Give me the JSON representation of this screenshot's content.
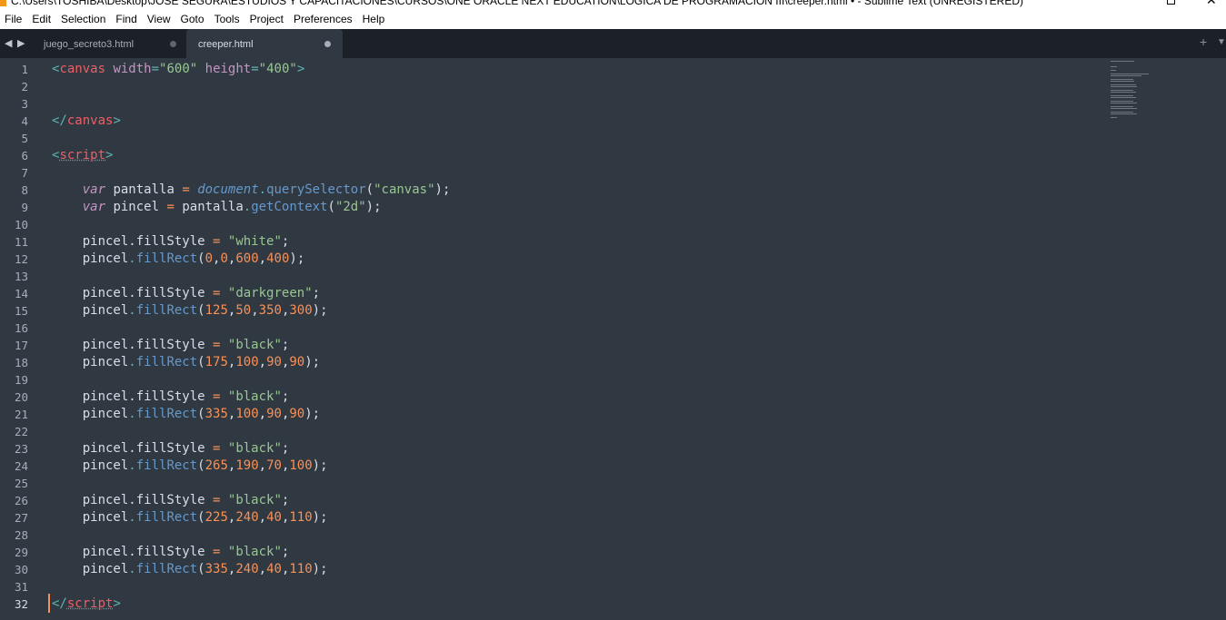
{
  "window": {
    "title": "C:\\Users\\TOSHIBA\\Desktop\\JOSE SEGURA\\ESTUDIOS Y CAPACITACIONES\\CURSOS\\ONE ORACLE NEXT EDUCATION\\LOGICA DE PROGRAMACION III\\creeper.html • - Sublime Text (UNREGISTERED)"
  },
  "menu": [
    "File",
    "Edit",
    "Selection",
    "Find",
    "View",
    "Goto",
    "Tools",
    "Project",
    "Preferences",
    "Help"
  ],
  "tabs": [
    {
      "label": "juego_secreto3.html",
      "active": false,
      "modified": true
    },
    {
      "label": "creeper.html",
      "active": true,
      "modified": true
    }
  ],
  "editor": {
    "current_line": 32,
    "lines": [
      {
        "n": "1",
        "tokens": [
          [
            "t-punct",
            "<"
          ],
          [
            "t-tag",
            "canvas"
          ],
          [
            "t-plain",
            " "
          ],
          [
            "t-attr",
            "width"
          ],
          [
            "t-punct",
            "="
          ],
          [
            "t-str",
            "\"600\""
          ],
          [
            "t-plain",
            " "
          ],
          [
            "t-attr",
            "height"
          ],
          [
            "t-punct",
            "="
          ],
          [
            "t-str",
            "\"400\""
          ],
          [
            "t-punct",
            ">"
          ]
        ]
      },
      {
        "n": "2",
        "tokens": []
      },
      {
        "n": "3",
        "tokens": []
      },
      {
        "n": "4",
        "tokens": [
          [
            "t-punct",
            "</"
          ],
          [
            "t-tag",
            "canvas"
          ],
          [
            "t-punct",
            ">"
          ]
        ]
      },
      {
        "n": "5",
        "tokens": []
      },
      {
        "n": "6",
        "tokens": [
          [
            "t-punct",
            "<"
          ],
          [
            "t-tag t-under",
            "script"
          ],
          [
            "t-punct",
            ">"
          ]
        ]
      },
      {
        "n": "7",
        "tokens": []
      },
      {
        "n": "8",
        "tokens": [
          [
            "t-plain",
            "    "
          ],
          [
            "t-kw",
            "var"
          ],
          [
            "t-plain",
            " "
          ],
          [
            "t-var",
            "pantalla"
          ],
          [
            "t-plain",
            " "
          ],
          [
            "t-op",
            "="
          ],
          [
            "t-plain",
            " "
          ],
          [
            "t-obj",
            "document"
          ],
          [
            "t-punct",
            "."
          ],
          [
            "t-fn",
            "querySelector"
          ],
          [
            "t-plain",
            "("
          ],
          [
            "t-str",
            "\"canvas\""
          ],
          [
            "t-plain",
            ");"
          ]
        ]
      },
      {
        "n": "9",
        "tokens": [
          [
            "t-plain",
            "    "
          ],
          [
            "t-kw",
            "var"
          ],
          [
            "t-plain",
            " "
          ],
          [
            "t-var",
            "pincel"
          ],
          [
            "t-plain",
            " "
          ],
          [
            "t-op",
            "="
          ],
          [
            "t-plain",
            " pantalla"
          ],
          [
            "t-punct",
            "."
          ],
          [
            "t-fn",
            "getContext"
          ],
          [
            "t-plain",
            "("
          ],
          [
            "t-str",
            "\"2d\""
          ],
          [
            "t-plain",
            ");"
          ]
        ]
      },
      {
        "n": "10",
        "tokens": []
      },
      {
        "n": "11",
        "tokens": [
          [
            "t-plain",
            "    pincel.fillStyle "
          ],
          [
            "t-op",
            "="
          ],
          [
            "t-plain",
            " "
          ],
          [
            "t-str",
            "\"white\""
          ],
          [
            "t-plain",
            ";"
          ]
        ]
      },
      {
        "n": "12",
        "tokens": [
          [
            "t-plain",
            "    pincel"
          ],
          [
            "t-punct",
            "."
          ],
          [
            "t-fn",
            "fillRect"
          ],
          [
            "t-plain",
            "("
          ],
          [
            "t-num",
            "0"
          ],
          [
            "t-plain",
            ","
          ],
          [
            "t-num",
            "0"
          ],
          [
            "t-plain",
            ","
          ],
          [
            "t-num",
            "600"
          ],
          [
            "t-plain",
            ","
          ],
          [
            "t-num",
            "400"
          ],
          [
            "t-plain",
            ");"
          ]
        ]
      },
      {
        "n": "13",
        "tokens": []
      },
      {
        "n": "14",
        "tokens": [
          [
            "t-plain",
            "    pincel.fillStyle "
          ],
          [
            "t-op",
            "="
          ],
          [
            "t-plain",
            " "
          ],
          [
            "t-str",
            "\"darkgreen\""
          ],
          [
            "t-plain",
            ";"
          ]
        ]
      },
      {
        "n": "15",
        "tokens": [
          [
            "t-plain",
            "    pincel"
          ],
          [
            "t-punct",
            "."
          ],
          [
            "t-fn",
            "fillRect"
          ],
          [
            "t-plain",
            "("
          ],
          [
            "t-num",
            "125"
          ],
          [
            "t-plain",
            ","
          ],
          [
            "t-num",
            "50"
          ],
          [
            "t-plain",
            ","
          ],
          [
            "t-num",
            "350"
          ],
          [
            "t-plain",
            ","
          ],
          [
            "t-num",
            "300"
          ],
          [
            "t-plain",
            ");"
          ]
        ]
      },
      {
        "n": "16",
        "tokens": []
      },
      {
        "n": "17",
        "tokens": [
          [
            "t-plain",
            "    pincel.fillStyle "
          ],
          [
            "t-op",
            "="
          ],
          [
            "t-plain",
            " "
          ],
          [
            "t-str",
            "\"black\""
          ],
          [
            "t-plain",
            ";"
          ]
        ]
      },
      {
        "n": "18",
        "tokens": [
          [
            "t-plain",
            "    pincel"
          ],
          [
            "t-punct",
            "."
          ],
          [
            "t-fn",
            "fillRect"
          ],
          [
            "t-plain",
            "("
          ],
          [
            "t-num",
            "175"
          ],
          [
            "t-plain",
            ","
          ],
          [
            "t-num",
            "100"
          ],
          [
            "t-plain",
            ","
          ],
          [
            "t-num",
            "90"
          ],
          [
            "t-plain",
            ","
          ],
          [
            "t-num",
            "90"
          ],
          [
            "t-plain",
            ");"
          ]
        ]
      },
      {
        "n": "19",
        "tokens": []
      },
      {
        "n": "20",
        "tokens": [
          [
            "t-plain",
            "    pincel.fillStyle "
          ],
          [
            "t-op",
            "="
          ],
          [
            "t-plain",
            " "
          ],
          [
            "t-str",
            "\"black\""
          ],
          [
            "t-plain",
            ";"
          ]
        ]
      },
      {
        "n": "21",
        "tokens": [
          [
            "t-plain",
            "    pincel"
          ],
          [
            "t-punct",
            "."
          ],
          [
            "t-fn",
            "fillRect"
          ],
          [
            "t-plain",
            "("
          ],
          [
            "t-num",
            "335"
          ],
          [
            "t-plain",
            ","
          ],
          [
            "t-num",
            "100"
          ],
          [
            "t-plain",
            ","
          ],
          [
            "t-num",
            "90"
          ],
          [
            "t-plain",
            ","
          ],
          [
            "t-num",
            "90"
          ],
          [
            "t-plain",
            ");"
          ]
        ]
      },
      {
        "n": "22",
        "tokens": []
      },
      {
        "n": "23",
        "tokens": [
          [
            "t-plain",
            "    pincel.fillStyle "
          ],
          [
            "t-op",
            "="
          ],
          [
            "t-plain",
            " "
          ],
          [
            "t-str",
            "\"black\""
          ],
          [
            "t-plain",
            ";"
          ]
        ]
      },
      {
        "n": "24",
        "tokens": [
          [
            "t-plain",
            "    pincel"
          ],
          [
            "t-punct",
            "."
          ],
          [
            "t-fn",
            "fillRect"
          ],
          [
            "t-plain",
            "("
          ],
          [
            "t-num",
            "265"
          ],
          [
            "t-plain",
            ","
          ],
          [
            "t-num",
            "190"
          ],
          [
            "t-plain",
            ","
          ],
          [
            "t-num",
            "70"
          ],
          [
            "t-plain",
            ","
          ],
          [
            "t-num",
            "100"
          ],
          [
            "t-plain",
            ");"
          ]
        ]
      },
      {
        "n": "25",
        "tokens": []
      },
      {
        "n": "26",
        "tokens": [
          [
            "t-plain",
            "    pincel.fillStyle "
          ],
          [
            "t-op",
            "="
          ],
          [
            "t-plain",
            " "
          ],
          [
            "t-str",
            "\"black\""
          ],
          [
            "t-plain",
            ";"
          ]
        ]
      },
      {
        "n": "27",
        "tokens": [
          [
            "t-plain",
            "    pincel"
          ],
          [
            "t-punct",
            "."
          ],
          [
            "t-fn",
            "fillRect"
          ],
          [
            "t-plain",
            "("
          ],
          [
            "t-num",
            "225"
          ],
          [
            "t-plain",
            ","
          ],
          [
            "t-num",
            "240"
          ],
          [
            "t-plain",
            ","
          ],
          [
            "t-num",
            "40"
          ],
          [
            "t-plain",
            ","
          ],
          [
            "t-num",
            "110"
          ],
          [
            "t-plain",
            ");"
          ]
        ]
      },
      {
        "n": "28",
        "tokens": []
      },
      {
        "n": "29",
        "tokens": [
          [
            "t-plain",
            "    pincel.fillStyle "
          ],
          [
            "t-op",
            "="
          ],
          [
            "t-plain",
            " "
          ],
          [
            "t-str",
            "\"black\""
          ],
          [
            "t-plain",
            ";"
          ]
        ]
      },
      {
        "n": "30",
        "tokens": [
          [
            "t-plain",
            "    pincel"
          ],
          [
            "t-punct",
            "."
          ],
          [
            "t-fn",
            "fillRect"
          ],
          [
            "t-plain",
            "("
          ],
          [
            "t-num",
            "335"
          ],
          [
            "t-plain",
            ","
          ],
          [
            "t-num",
            "240"
          ],
          [
            "t-plain",
            ","
          ],
          [
            "t-num",
            "40"
          ],
          [
            "t-plain",
            ","
          ],
          [
            "t-num",
            "110"
          ],
          [
            "t-plain",
            ");"
          ]
        ]
      },
      {
        "n": "31",
        "tokens": []
      },
      {
        "n": "32",
        "tokens": [
          [
            "t-punct",
            "</"
          ],
          [
            "t-tag t-under",
            "script"
          ],
          [
            "t-punct",
            ">"
          ]
        ]
      }
    ]
  },
  "icons": {
    "nav_left": "◀",
    "nav_right": "▶",
    "new_tab": "+",
    "tab_list": "▼",
    "window_close": "✕"
  }
}
